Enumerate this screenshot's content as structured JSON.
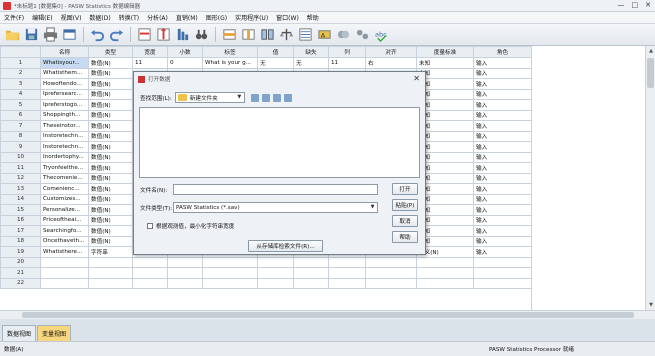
{
  "window": {
    "title": "*未标题1 [数据集0] - PASW Statistics 数据编辑器",
    "controls": [
      "—",
      "□",
      "✕"
    ]
  },
  "menu": [
    "文件(F)",
    "编辑(E)",
    "视图(V)",
    "数据(D)",
    "转换(T)",
    "分析(A)",
    "直销(M)",
    "图形(G)",
    "实用程序(U)",
    "窗口(W)",
    "帮助"
  ],
  "toolbar_icons": [
    "open-folder-icon",
    "save-icon",
    "print-icon",
    "dialog-recall-icon",
    "undo-icon",
    "redo-icon",
    "goto-case-icon",
    "goto-variable-icon",
    "variables-icon",
    "find-icon",
    "insert-cases-icon",
    "insert-variable-icon",
    "split-file-icon",
    "weight-cases-icon",
    "select-cases-icon",
    "value-labels-icon",
    "use-sets-icon",
    "show-all-icon",
    "spell-icon"
  ],
  "columns": [
    "名称",
    "类型",
    "宽度",
    "小数",
    "标签",
    "值",
    "缺失",
    "列",
    "对齐",
    "度量标准",
    "角色"
  ],
  "rows": [
    {
      "n": "1",
      "name": "Whatisyour...",
      "type": "数值(N)",
      "width": "11",
      "dec": "0",
      "label": "What is your g...",
      "values": "无",
      "missing": "无",
      "cols": "11",
      "align": "右",
      "measure": "未知",
      "role": "输入"
    },
    {
      "n": "2",
      "name": "Whatisthem...",
      "type": "数值(N)",
      "width": "",
      "dec": "",
      "label": "",
      "values": "",
      "missing": "",
      "cols": "",
      "align": "",
      "measure": "未知",
      "role": "输入"
    },
    {
      "n": "3",
      "name": "Howoftendo...",
      "type": "数值(N)",
      "width": "",
      "dec": "",
      "label": "",
      "values": "",
      "missing": "",
      "cols": "",
      "align": "",
      "measure": "未知",
      "role": "输入"
    },
    {
      "n": "4",
      "name": "Iprefersearc...",
      "type": "数值(N)",
      "width": "",
      "dec": "",
      "label": "",
      "values": "",
      "missing": "",
      "cols": "",
      "align": "",
      "measure": "未知",
      "role": "输入"
    },
    {
      "n": "5",
      "name": "Ipreferstogo...",
      "type": "数值(N)",
      "width": "",
      "dec": "",
      "label": "",
      "values": "",
      "missing": "",
      "cols": "",
      "align": "",
      "measure": "未知",
      "role": "输入"
    },
    {
      "n": "6",
      "name": "Shoppingth...",
      "type": "数值(N)",
      "width": "",
      "dec": "",
      "label": "",
      "values": "",
      "missing": "",
      "cols": "",
      "align": "",
      "measure": "未知",
      "role": "输入"
    },
    {
      "n": "7",
      "name": "Theseinstor...",
      "type": "数值(N)",
      "width": "",
      "dec": "",
      "label": "",
      "values": "",
      "missing": "",
      "cols": "",
      "align": "",
      "measure": "未知",
      "role": "输入"
    },
    {
      "n": "8",
      "name": "Instoretechn...",
      "type": "数值(N)",
      "width": "",
      "dec": "",
      "label": "",
      "values": "",
      "missing": "",
      "cols": "",
      "align": "",
      "measure": "未知",
      "role": "输入"
    },
    {
      "n": "9",
      "name": "Instoretechn...",
      "type": "数值(N)",
      "width": "",
      "dec": "",
      "label": "",
      "values": "",
      "missing": "",
      "cols": "",
      "align": "",
      "measure": "未知",
      "role": "输入"
    },
    {
      "n": "10",
      "name": "Inordertophy...",
      "type": "数值(N)",
      "width": "",
      "dec": "",
      "label": "",
      "values": "",
      "missing": "",
      "cols": "",
      "align": "",
      "measure": "未知",
      "role": "输入"
    },
    {
      "n": "11",
      "name": "Tryonfeelthe...",
      "type": "数值(N)",
      "width": "",
      "dec": "",
      "label": "",
      "values": "",
      "missing": "",
      "cols": "",
      "align": "",
      "measure": "未知",
      "role": "输入"
    },
    {
      "n": "12",
      "name": "Thecomenie...",
      "type": "数值(N)",
      "width": "",
      "dec": "",
      "label": "",
      "values": "",
      "missing": "",
      "cols": "",
      "align": "",
      "measure": "未知",
      "role": "输入"
    },
    {
      "n": "13",
      "name": "Comenienc...",
      "type": "数值(N)",
      "width": "",
      "dec": "",
      "label": "",
      "values": "",
      "missing": "",
      "cols": "",
      "align": "",
      "measure": "未知",
      "role": "输入"
    },
    {
      "n": "14",
      "name": "Customizes...",
      "type": "数值(N)",
      "width": "",
      "dec": "",
      "label": "",
      "values": "",
      "missing": "",
      "cols": "",
      "align": "",
      "measure": "未知",
      "role": "输入"
    },
    {
      "n": "15",
      "name": "Personalize...",
      "type": "数值(N)",
      "width": "",
      "dec": "",
      "label": "",
      "values": "",
      "missing": "",
      "cols": "",
      "align": "",
      "measure": "未知",
      "role": "输入"
    },
    {
      "n": "16",
      "name": "Priceoftheai...",
      "type": "数值(N)",
      "width": "",
      "dec": "",
      "label": "",
      "values": "",
      "missing": "",
      "cols": "",
      "align": "",
      "measure": "未知",
      "role": "输入"
    },
    {
      "n": "17",
      "name": "Searchingfo...",
      "type": "数值(N)",
      "width": "",
      "dec": "",
      "label": "",
      "values": "",
      "missing": "",
      "cols": "",
      "align": "",
      "measure": "未知",
      "role": "输入"
    },
    {
      "n": "18",
      "name": "Oncethaveth...",
      "type": "数值(N)",
      "width": "11",
      "dec": "0",
      "label": "Once I have the...",
      "values": "无",
      "missing": "无",
      "cols": "11",
      "align": "右",
      "measure": "未知",
      "role": "输入"
    },
    {
      "n": "19",
      "name": "Whatisthere...",
      "type": "字符串",
      "width": "338",
      "dec": "0",
      "label": "What is the rea...",
      "values": "无",
      "missing": "无",
      "cols": "50",
      "align": "左",
      "measure": "名义(N)",
      "role": "输入"
    },
    {
      "n": "20",
      "name": "",
      "type": "",
      "width": "",
      "dec": "",
      "label": "",
      "values": "",
      "missing": "",
      "cols": "",
      "align": "",
      "measure": "",
      "role": ""
    },
    {
      "n": "21",
      "name": "",
      "type": "",
      "width": "",
      "dec": "",
      "label": "",
      "values": "",
      "missing": "",
      "cols": "",
      "align": "",
      "measure": "",
      "role": ""
    },
    {
      "n": "22",
      "name": "",
      "type": "",
      "width": "",
      "dec": "",
      "label": "",
      "values": "",
      "missing": "",
      "cols": "",
      "align": "",
      "measure": "",
      "role": ""
    }
  ],
  "tabs": {
    "data_view": "数据视图",
    "variable_view": "变量视图"
  },
  "status": {
    "left": "数据(A)",
    "right": "PASW Statistics Processor 就绪"
  },
  "dialog": {
    "title": "打开数据",
    "lookin_label": "查找范围(L):",
    "lookin_value": "新建文件夹",
    "filename_label": "文件名(N):",
    "filename_value": "",
    "filetype_label": "文件类型(T):",
    "filetype_value": "PASW Statistics (*.sav)",
    "checkbox_label": "根据观测值，最小化字符串宽度",
    "btn_open": "打开",
    "btn_paste": "粘贴(P)",
    "btn_cancel": "取消",
    "btn_help": "帮助",
    "btn_repo": "从存储库检索文件(R)..."
  },
  "colors": {
    "active_tab": "#f7d67d",
    "selected_cell": "#c6dbf2",
    "header_bg": "#e9eef3"
  }
}
